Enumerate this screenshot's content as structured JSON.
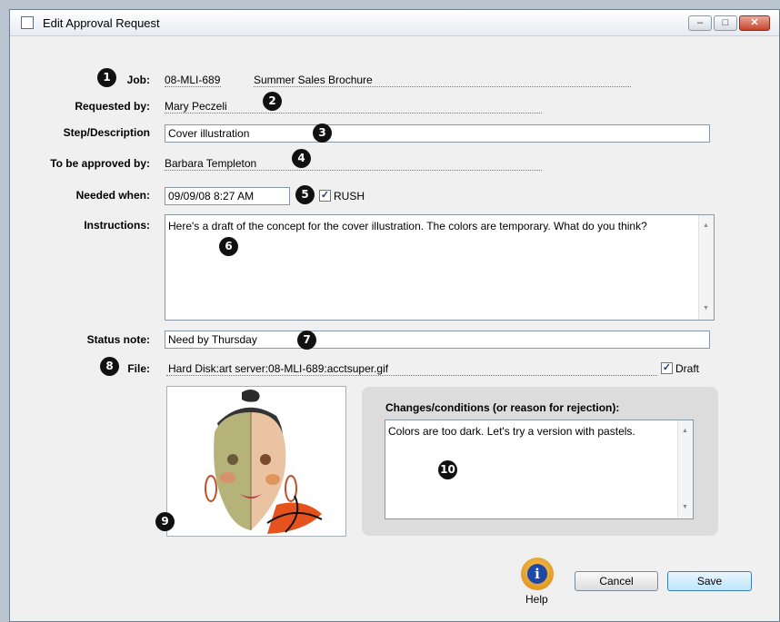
{
  "window": {
    "title": "Edit Approval Request"
  },
  "fields": {
    "job_label": "Job:",
    "job_number": "08-MLI-689",
    "job_name": "Summer Sales Brochure",
    "requested_by_label": "Requested by:",
    "requested_by": "Mary Peczeli",
    "step_label": "Step/Description",
    "step_value": "Cover illustration",
    "approved_by_label": "To be approved by:",
    "approved_by": "Barbara Templeton",
    "needed_label": "Needed when:",
    "needed_value": "09/09/08 8:27 AM",
    "rush_label": "RUSH",
    "rush_checked": true,
    "instructions_label": "Instructions:",
    "instructions_value": "Here's a draft of the concept for the cover illustration. The colors are temporary. What do you think?",
    "status_label": "Status note:",
    "status_value": "Need by Thursday",
    "file_label": "File:",
    "file_value": "Hard Disk:art server:08-MLI-689:acctsuper.gif",
    "draft_label": "Draft",
    "draft_checked": true
  },
  "changes": {
    "heading": "Changes/conditions (or reason for rejection):",
    "value": "Colors are too dark. Let's try a version with pastels."
  },
  "buttons": {
    "help": "Help",
    "cancel": "Cancel",
    "save": "Save"
  },
  "callouts": [
    "1",
    "2",
    "3",
    "4",
    "5",
    "6",
    "7",
    "8",
    "9",
    "10"
  ],
  "checkmark": "✓"
}
